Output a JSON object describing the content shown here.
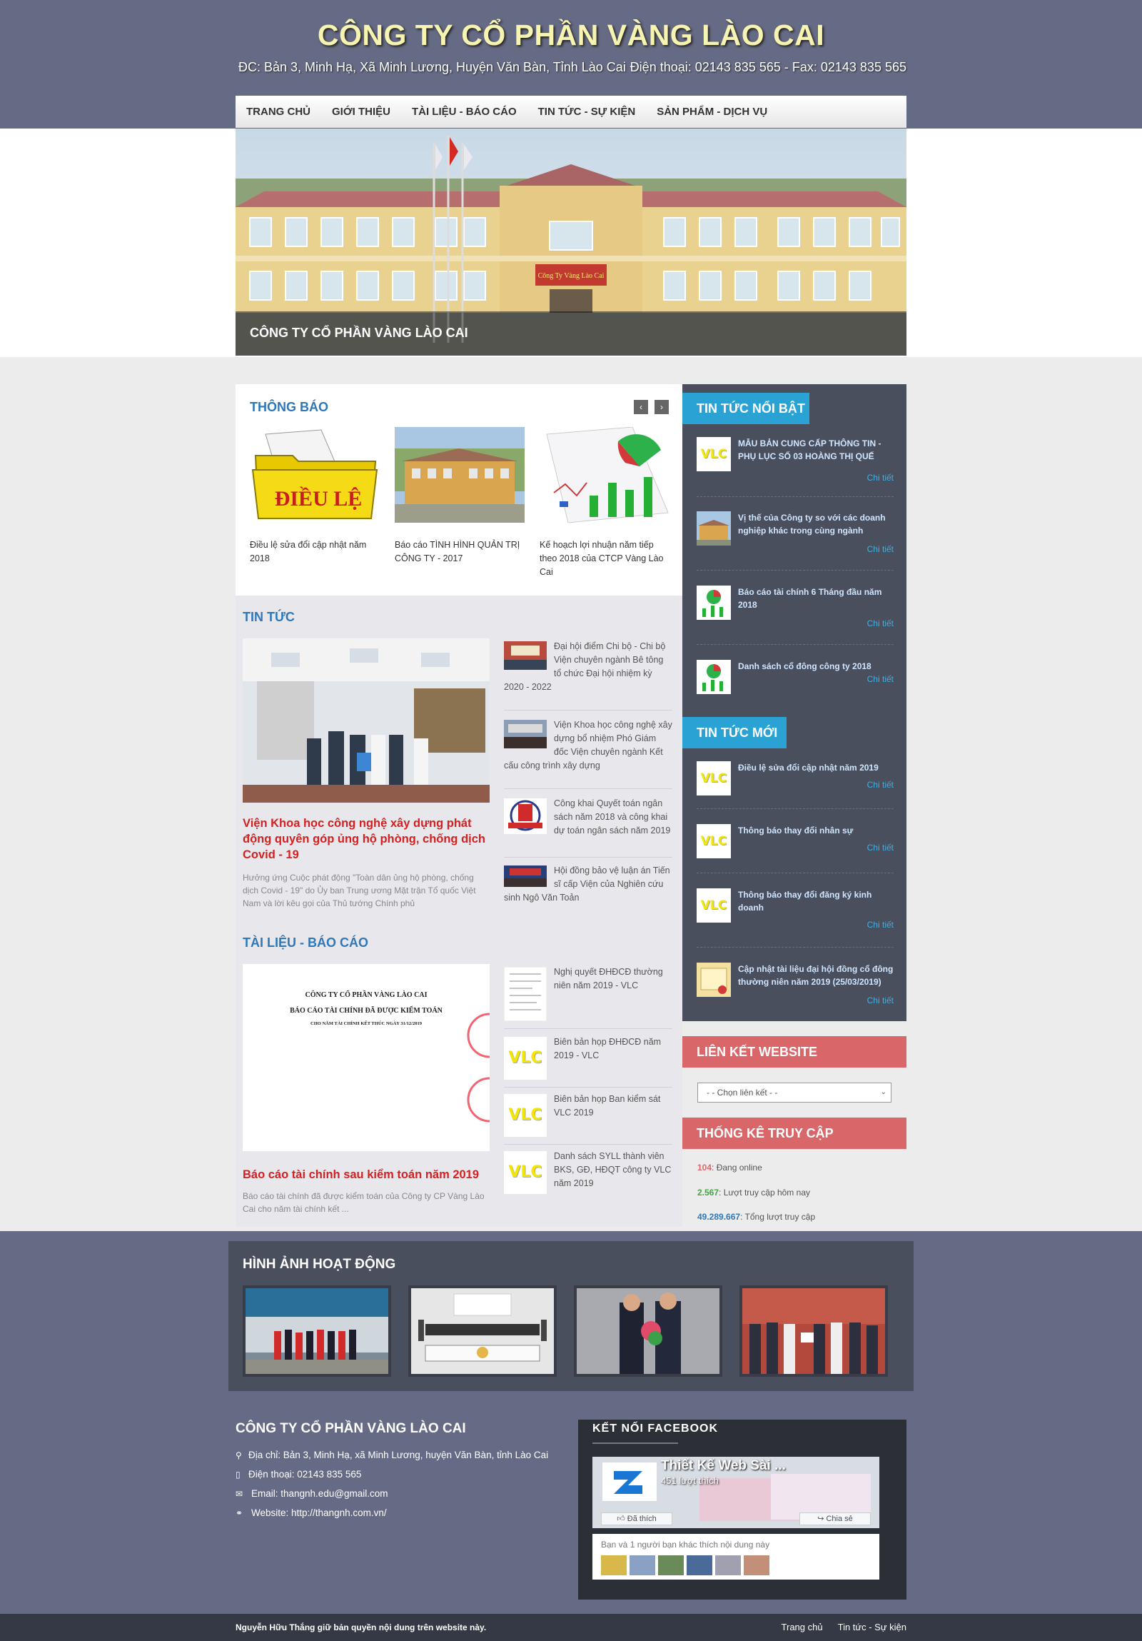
{
  "header": {
    "site_title": "CÔNG TY CỔ PHẦN VÀNG LÀO CAI",
    "address": "ĐC: Bản 3, Minh Hạ, Xã Minh Lương, Huyện Văn Bàn, Tỉnh Lào Cai",
    "phone_fax": "Điện thoại: 02143 835 565 - Fax: 02143 835 565"
  },
  "nav": [
    "TRANG CHỦ",
    "GIỚI THIỆU",
    "TÀI LIỆU - BÁO CÁO",
    "TIN TỨC - SỰ KIỆN",
    "SẢN PHẨM - DỊCH VỤ"
  ],
  "banner": {
    "caption": "CÔNG TY CỔ PHẦN VÀNG LÀO CAI",
    "sign": "Công Ty Vàng Lào Cai"
  },
  "announcements": {
    "title": "THÔNG BÁO",
    "prev": "‹",
    "next": "›",
    "items": [
      {
        "caption": "Điều lệ sửa đổi cập nhật năm 2018",
        "thumb_text": "ĐIỀU LỆ"
      },
      {
        "caption": "Báo cáo TÌNH HÌNH QUẢN TRỊ CÔNG TY - 2017"
      },
      {
        "caption": "Kế hoạch lợi nhuận năm tiếp theo 2018 của CTCP Vàng Lào Cai"
      }
    ]
  },
  "news": {
    "title": "TIN TỨC",
    "main": {
      "title": "Viện Khoa học công nghệ xây dựng phát động quyên góp ủng hộ phòng, chống dịch Covid - 19",
      "desc": "Hưởng ứng Cuộc phát động \"Toàn dân ủng hộ phòng, chống dịch Covid - 19\" do Ủy ban Trung ương Mặt trận Tổ quốc Việt Nam và lời kêu gọi của Thủ tướng Chính phủ"
    },
    "side": [
      "Đại hội điểm Chi bộ - Chi bộ Viện chuyên ngành Bê tông tổ chức Đại hội nhiệm kỳ 2020 - 2022",
      "Viện Khoa học công nghệ xây dựng bổ nhiệm Phó Giám đốc Viện chuyên ngành Kết cấu công trình xây dựng",
      "Công khai Quyết toán ngân sách năm 2018 và công khai dự toán ngân sách năm 2019",
      "Hội đồng bảo vệ luận án Tiến sĩ cấp Viện của Nghiên cứu sinh Ngô Văn Toản"
    ]
  },
  "docs": {
    "title": "TÀI LIỆU - BÁO CÁO",
    "doc_preview": {
      "line1": "CÔNG TY CỔ PHẦN VÀNG LÀO CAI",
      "line2": "BÁO CÁO TÀI CHÍNH ĐÃ ĐƯỢC KIỂM TOÁN",
      "line3": "CHO NĂM TÀI CHÍNH KẾT THÚC NGÀY 31/12/2019"
    },
    "main": {
      "title": "Báo cáo tài chính sau kiểm toán năm 2019",
      "desc": "Báo cáo tài chính đã được kiểm toán của Công ty CP Vàng Lào Cai cho năm tài chính kết ..."
    },
    "side": [
      "Nghị quyết ĐHĐCĐ thường niên năm 2019 - VLC",
      "Biên bản họp ĐHĐCĐ năm 2019 - VLC",
      "Biên bản họp Ban kiểm sát VLC 2019",
      "Danh sách SYLL thành viên BKS, GĐ, HĐQT công ty VLC năm 2019"
    ]
  },
  "featured": {
    "title": "TIN TỨC NỔI BẬT",
    "more": "Chi tiết",
    "items": [
      "MẪU BẢN CUNG CẤP THÔNG TIN - PHỤ LỤC SỐ 03 HOÀNG THỊ QUẾ",
      "Vị thế của Công ty so với các doanh nghiệp khác trong cùng ngành",
      "Báo cáo tài chính 6 Tháng đầu năm 2018",
      "Danh sách cổ đông công ty 2018"
    ]
  },
  "latest": {
    "title": "TIN TỨC MỚI",
    "items": [
      "Điều lệ sửa đổi cập nhật năm 2019",
      "Thông báo thay đổi nhân sự",
      "Thông báo thay đổi đăng ký kinh doanh",
      "Cập nhật tài liệu đại hội đồng cổ đông thường niên năm 2019 (25/03/2019)"
    ]
  },
  "vlc_logo": "VLC",
  "links": {
    "title": "LIÊN KẾT WEBSITE",
    "select": "- - Chọn liên kết - -"
  },
  "stats": {
    "title": "THỐNG KÊ TRUY CẬP",
    "online_num": "104",
    "online_label": ": Đang online",
    "today_num": "2.567",
    "today_label": ": Lượt truy cập hôm nay",
    "total_num": "49.289.667",
    "total_label": ": Tổng lượt truy cập"
  },
  "gallery": {
    "title": "HÌNH ẢNH HOẠT ĐỘNG"
  },
  "footer": {
    "company": "CÔNG TY CỔ PHẦN VÀNG LÀO CAI",
    "address": "Địa chỉ: Bản 3, Minh Hạ, xã Minh Lương, huyện Văn Bàn, tỉnh Lào Cai",
    "phone": "Điện thoại: 02143 835 565",
    "email": "Email: thangnh.edu@gmail.com",
    "website": "Website: http://thangnh.com.vn/",
    "copyright": "Nguyễn Hữu Thắng giữ bản quyền nội dung trên website này.",
    "link_home": "Trang chủ",
    "link_news": "Tin tức - Sự kiện"
  },
  "facebook": {
    "title": "KẾT NỐI FACEBOOK",
    "page_name": "Thiết Kế Web Sài ...",
    "likes": "451 lượt thích",
    "like_btn": "Đã thích",
    "share_btn": "Chia sẻ",
    "friends": "Bạn và 1 người bạn khác thích nội dung này"
  },
  "colors": {
    "header_bg": "#666b85",
    "accent_blue": "#2aa2d4",
    "accent_red": "#d9676a",
    "title_red": "#d42020"
  }
}
